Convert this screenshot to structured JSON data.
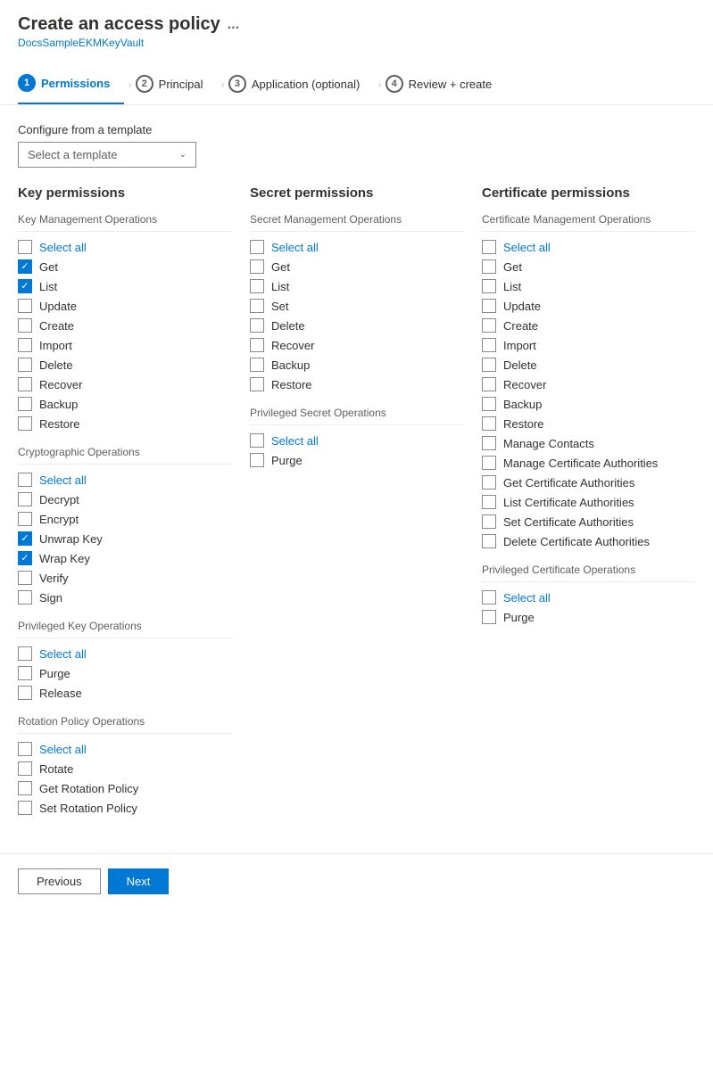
{
  "header": {
    "title": "Create an access policy",
    "subtitle": "DocsSampleEKMKeyVault",
    "dots": "..."
  },
  "wizard": {
    "steps": [
      {
        "id": "permissions",
        "number": "1",
        "label": "Permissions",
        "active": true
      },
      {
        "id": "principal",
        "number": "2",
        "label": "Principal",
        "active": false
      },
      {
        "id": "application",
        "number": "3",
        "label": "Application (optional)",
        "active": false
      },
      {
        "id": "review",
        "number": "4",
        "label": "Review + create",
        "active": false
      }
    ]
  },
  "template": {
    "label": "Configure from a template",
    "placeholder": "Select a template"
  },
  "key_permissions": {
    "title": "Key permissions",
    "sections": [
      {
        "title": "Key Management Operations",
        "items": [
          {
            "label": "Select all",
            "checked": false,
            "select_all": true
          },
          {
            "label": "Get",
            "checked": true
          },
          {
            "label": "List",
            "checked": true
          },
          {
            "label": "Update",
            "checked": false
          },
          {
            "label": "Create",
            "checked": false
          },
          {
            "label": "Import",
            "checked": false
          },
          {
            "label": "Delete",
            "checked": false
          },
          {
            "label": "Recover",
            "checked": false
          },
          {
            "label": "Backup",
            "checked": false
          },
          {
            "label": "Restore",
            "checked": false
          }
        ]
      },
      {
        "title": "Cryptographic Operations",
        "items": [
          {
            "label": "Select all",
            "checked": false,
            "select_all": true
          },
          {
            "label": "Decrypt",
            "checked": false
          },
          {
            "label": "Encrypt",
            "checked": false
          },
          {
            "label": "Unwrap Key",
            "checked": true
          },
          {
            "label": "Wrap Key",
            "checked": true
          },
          {
            "label": "Verify",
            "checked": false
          },
          {
            "label": "Sign",
            "checked": false
          }
        ]
      },
      {
        "title": "Privileged Key Operations",
        "items": [
          {
            "label": "Select all",
            "checked": false,
            "select_all": true
          },
          {
            "label": "Purge",
            "checked": false
          },
          {
            "label": "Release",
            "checked": false
          }
        ]
      },
      {
        "title": "Rotation Policy Operations",
        "items": [
          {
            "label": "Select all",
            "checked": false,
            "select_all": true
          },
          {
            "label": "Rotate",
            "checked": false
          },
          {
            "label": "Get Rotation Policy",
            "checked": false
          },
          {
            "label": "Set Rotation Policy",
            "checked": false
          }
        ]
      }
    ]
  },
  "secret_permissions": {
    "title": "Secret permissions",
    "sections": [
      {
        "title": "Secret Management Operations",
        "items": [
          {
            "label": "Select all",
            "checked": false,
            "select_all": true
          },
          {
            "label": "Get",
            "checked": false
          },
          {
            "label": "List",
            "checked": false
          },
          {
            "label": "Set",
            "checked": false
          },
          {
            "label": "Delete",
            "checked": false
          },
          {
            "label": "Recover",
            "checked": false
          },
          {
            "label": "Backup",
            "checked": false
          },
          {
            "label": "Restore",
            "checked": false
          }
        ]
      },
      {
        "title": "Privileged Secret Operations",
        "items": [
          {
            "label": "Select all",
            "checked": false,
            "select_all": true
          },
          {
            "label": "Purge",
            "checked": false
          }
        ]
      }
    ]
  },
  "certificate_permissions": {
    "title": "Certificate permissions",
    "sections": [
      {
        "title": "Certificate Management Operations",
        "items": [
          {
            "label": "Select all",
            "checked": false,
            "select_all": true
          },
          {
            "label": "Get",
            "checked": false
          },
          {
            "label": "List",
            "checked": false
          },
          {
            "label": "Update",
            "checked": false
          },
          {
            "label": "Create",
            "checked": false
          },
          {
            "label": "Import",
            "checked": false
          },
          {
            "label": "Delete",
            "checked": false
          },
          {
            "label": "Recover",
            "checked": false
          },
          {
            "label": "Backup",
            "checked": false
          },
          {
            "label": "Restore",
            "checked": false
          },
          {
            "label": "Manage Contacts",
            "checked": false
          },
          {
            "label": "Manage Certificate Authorities",
            "checked": false
          },
          {
            "label": "Get Certificate Authorities",
            "checked": false
          },
          {
            "label": "List Certificate Authorities",
            "checked": false
          },
          {
            "label": "Set Certificate Authorities",
            "checked": false
          },
          {
            "label": "Delete Certificate Authorities",
            "checked": false
          }
        ]
      },
      {
        "title": "Privileged Certificate Operations",
        "items": [
          {
            "label": "Select all",
            "checked": false,
            "select_all": true
          },
          {
            "label": "Purge",
            "checked": false
          }
        ]
      }
    ]
  },
  "footer": {
    "previous_label": "Previous",
    "next_label": "Next"
  }
}
